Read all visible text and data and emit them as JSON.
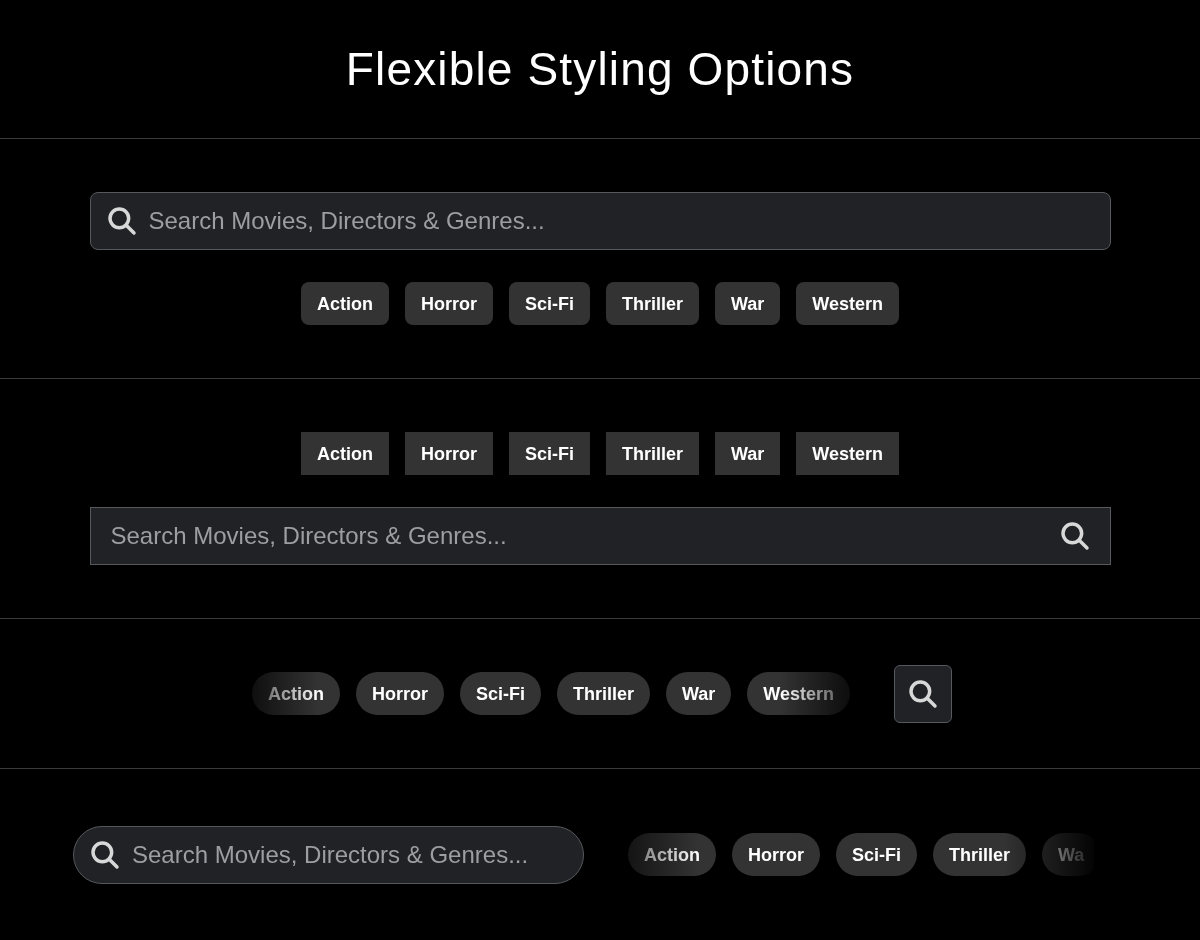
{
  "title": "Flexible Styling Options",
  "sections": [
    {
      "kind": "rounded",
      "search": {
        "placeholder": "Search Movies, Directors & Genres..."
      },
      "chips": [
        "Action",
        "Horror",
        "Sci-Fi",
        "Thriller",
        "War",
        "Western"
      ]
    },
    {
      "kind": "square",
      "search": {
        "placeholder": "Search Movies, Directors & Genres..."
      },
      "chips": [
        "Action",
        "Horror",
        "Sci-Fi",
        "Thriller",
        "War",
        "Western"
      ]
    },
    {
      "kind": "pill-button",
      "chips": [
        "Action",
        "Horror",
        "Sci-Fi",
        "Thriller",
        "War",
        "Western"
      ]
    },
    {
      "kind": "pill-scroll",
      "search": {
        "placeholder": "Search Movies, Directors & Genres..."
      },
      "chips": [
        "Action",
        "Horror",
        "Sci-Fi",
        "Thriller",
        "Wa"
      ]
    }
  ]
}
